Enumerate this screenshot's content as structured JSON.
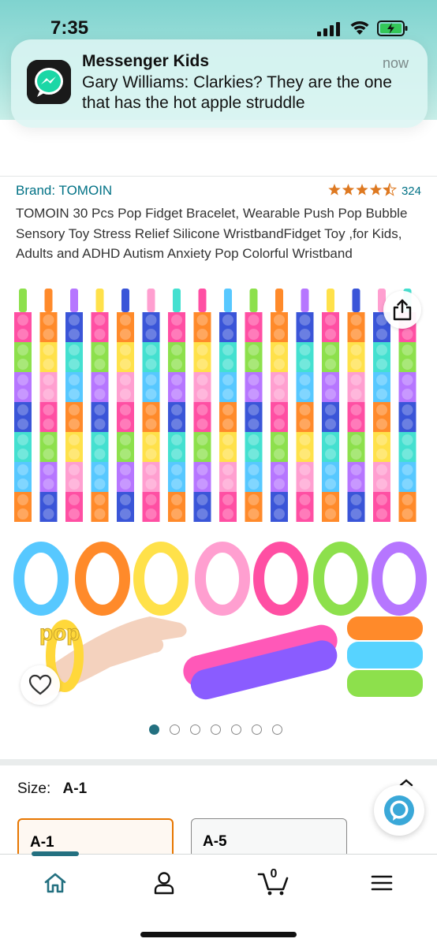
{
  "status_bar": {
    "time": "7:35"
  },
  "notification": {
    "app_name": "Messenger Kids",
    "time": "now",
    "message": "Gary Williams: Clarkies?  They are the one that has the hot apple struddle"
  },
  "product": {
    "brand": "Brand: TOMOIN",
    "rating": 4.5,
    "rating_count": "324",
    "title": "TOMOIN 30 Pcs Pop Fidget Bracelet, Wearable Push Pop Bubble Sensory Toy Stress Relief Silicone WristbandFidget Toy ,for Kids, Adults and ADHD Autism Anxiety Pop Colorful Wristband",
    "image_badge_text": "pop",
    "image_count": 7,
    "active_image": 1
  },
  "size": {
    "label": "Size:",
    "selected": "A-1",
    "options": [
      "A-1",
      "A-5"
    ]
  },
  "bottom_nav": {
    "items": [
      "home-icon",
      "account-icon",
      "cart-icon",
      "menu-icon"
    ],
    "cart_count": "0"
  },
  "colors": {
    "link": "#007185",
    "star": "#de7921",
    "selected_border": "#e77600",
    "accent": "#237080"
  }
}
